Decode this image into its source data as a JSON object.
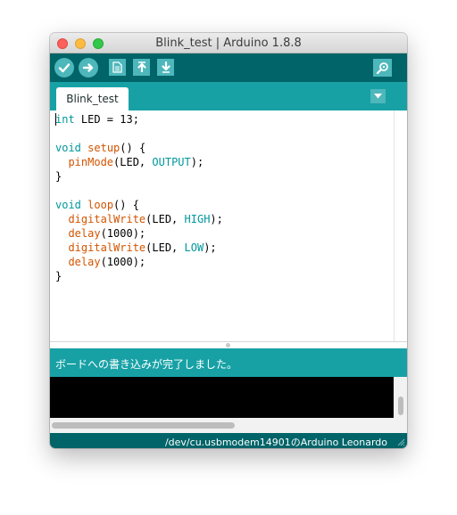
{
  "window": {
    "title": "Blink_test | Arduino 1.8.8"
  },
  "toolbar": {
    "buttons": [
      {
        "name": "verify",
        "icon": "check-icon"
      },
      {
        "name": "upload",
        "icon": "arrow-right-icon"
      },
      {
        "name": "new",
        "icon": "document-icon"
      },
      {
        "name": "open",
        "icon": "arrow-up-icon"
      },
      {
        "name": "save",
        "icon": "arrow-down-icon"
      },
      {
        "name": "serial-monitor",
        "icon": "magnifier-icon"
      }
    ]
  },
  "tabs": [
    {
      "label": "Blink_test",
      "active": true
    }
  ],
  "editor": {
    "lines": [
      "int LED = 13;",
      "",
      "void setup() {",
      "  pinMode(LED, OUTPUT);",
      "}",
      "",
      "void loop() {",
      "  digitalWrite(LED, HIGH);",
      "  delay(1000);",
      "  digitalWrite(LED, LOW);",
      "  delay(1000);",
      "}"
    ]
  },
  "status": {
    "message": "ボードへの書き込みが完了しました。"
  },
  "footer": {
    "board_info": "/dev/cu.usbmodem14901のArduino Leonardo"
  },
  "colors": {
    "toolbar_bg": "#006468",
    "tabbar_bg": "#17a1a5",
    "button_bg": "#4db7bb",
    "keyword": "#00979d",
    "function": "#d35400"
  }
}
